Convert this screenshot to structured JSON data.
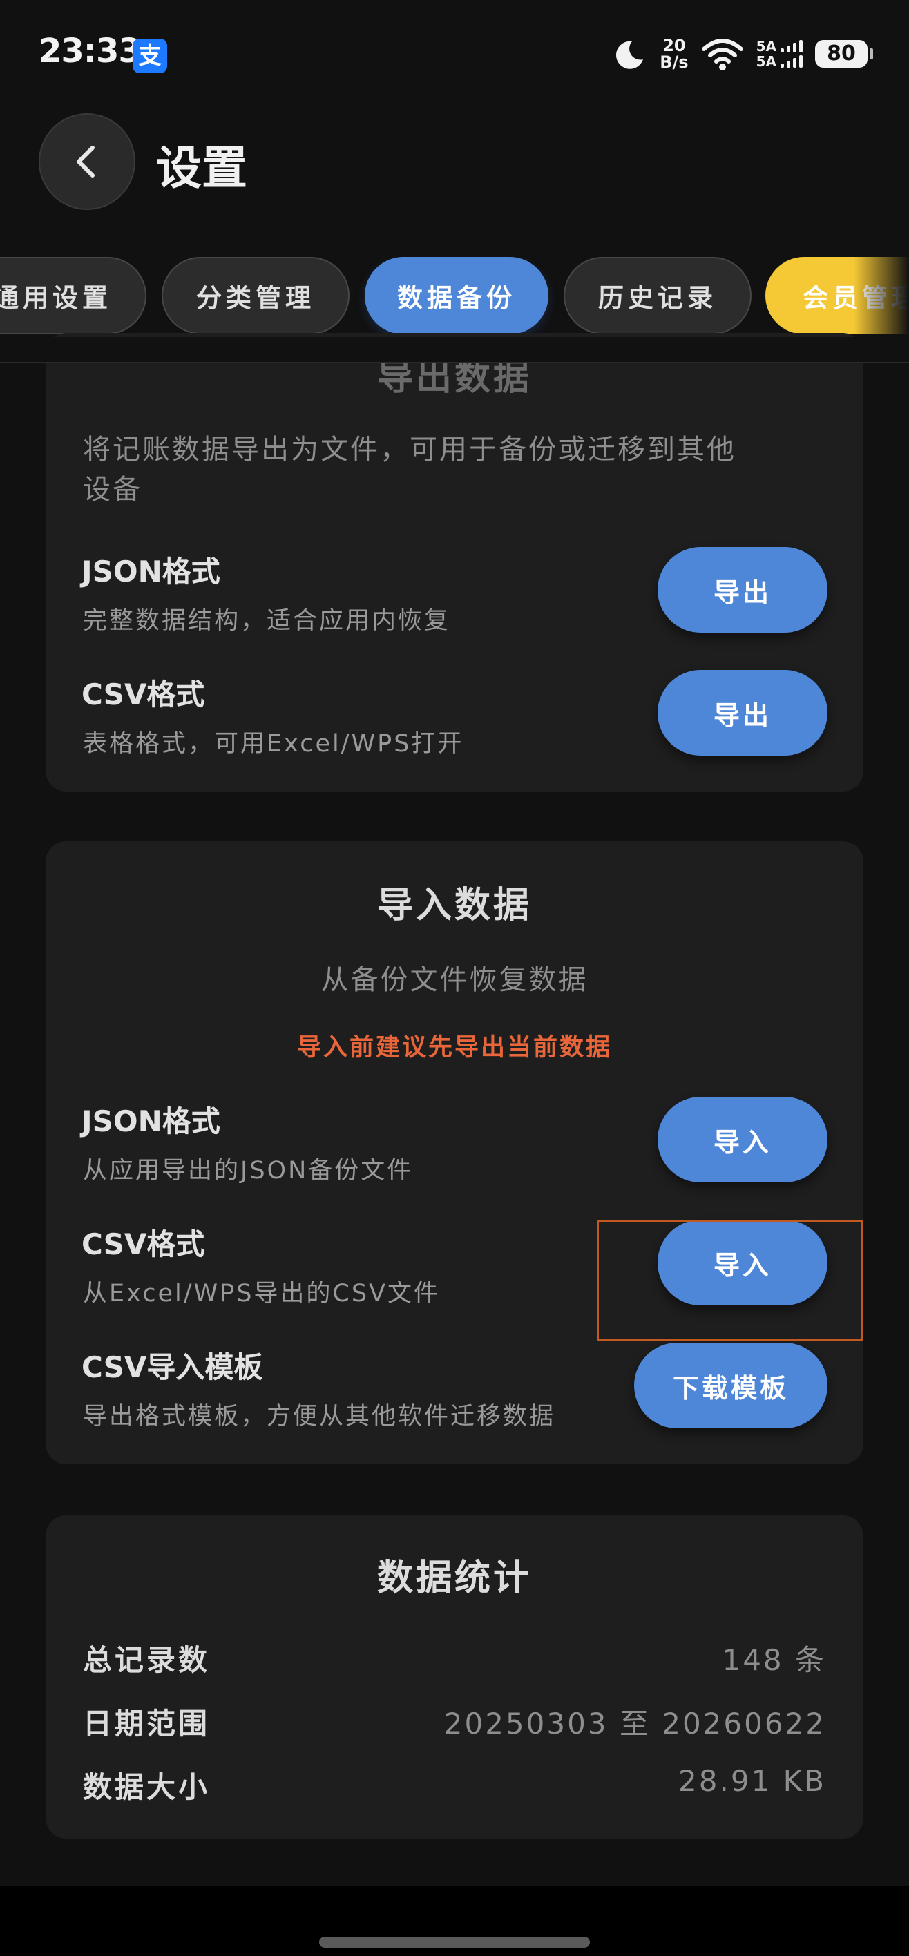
{
  "status_bar": {
    "time": "23:33",
    "alipay_glyph": "支",
    "net_speed_value": "20",
    "net_speed_unit": "B/s",
    "sig1": "5A",
    "sig2": "5A",
    "battery": "80"
  },
  "header": {
    "title": "设置"
  },
  "tabs": [
    {
      "label": "通用设置",
      "state": "inactive"
    },
    {
      "label": "分类管理",
      "state": "inactive"
    },
    {
      "label": "数据备份",
      "state": "active"
    },
    {
      "label": "历史记录",
      "state": "inactive"
    },
    {
      "label": "会员管理",
      "state": "vip"
    }
  ],
  "export_card": {
    "title": "导出数据",
    "desc_line1": "将记账数据导出为文件，可用于备份或迁移到其他",
    "desc_line2": "设备",
    "rows": [
      {
        "title": "JSON格式",
        "sub": "完整数据结构，适合应用内恢复",
        "button": "导出"
      },
      {
        "title": "CSV格式",
        "sub": "表格格式，可用Excel/WPS打开",
        "button": "导出"
      }
    ]
  },
  "import_card": {
    "title": "导入数据",
    "desc": "从备份文件恢复数据",
    "warning": "导入前建议先导出当前数据",
    "rows": [
      {
        "title": "JSON格式",
        "sub": "从应用导出的JSON备份文件",
        "button": "导入"
      },
      {
        "title": "CSV格式",
        "sub": "从Excel/WPS导出的CSV文件",
        "button": "导入"
      },
      {
        "title": "CSV导入模板",
        "sub": "导出格式模板，方便从其他软件迁移数据",
        "button": "下载模板"
      }
    ]
  },
  "stats_card": {
    "title": "数据统计",
    "rows": [
      {
        "label": "总记录数",
        "value": "148 条"
      },
      {
        "label": "日期范围",
        "value": "20250303 至 20260622"
      },
      {
        "label": "数据大小",
        "value": "28.91 KB"
      }
    ]
  },
  "colors": {
    "accent": "#4f87d8",
    "vip": "#f5c836",
    "warning": "#e8663a",
    "card_bg": "#1e1e1e",
    "page_bg": "#111111"
  }
}
